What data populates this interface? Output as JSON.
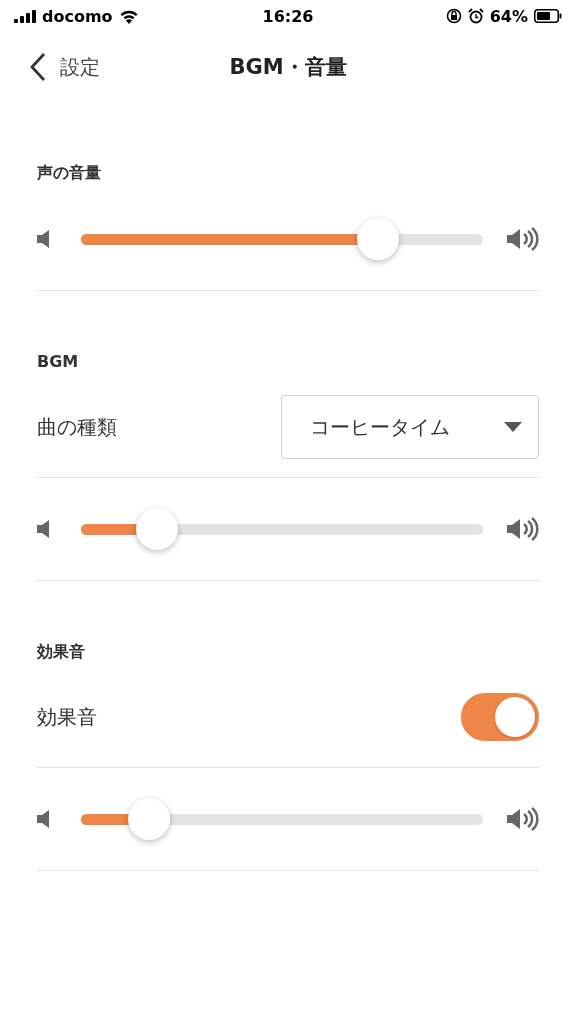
{
  "status_bar": {
    "carrier": "docomo",
    "time": "16:26",
    "battery": "64%"
  },
  "nav": {
    "back": "設定",
    "title": "BGM・音量"
  },
  "sections": [
    {
      "title": "声の音量",
      "rows": [
        {
          "kind": "slider",
          "level": 0.74
        }
      ]
    },
    {
      "title": "BGM",
      "rows": [
        {
          "kind": "select",
          "label": "曲の種類",
          "value": "コーヒータイム"
        },
        {
          "kind": "slider",
          "level": 0.19
        }
      ]
    },
    {
      "title": "効果音",
      "rows": [
        {
          "kind": "toggle",
          "label": "効果音",
          "on": true
        },
        {
          "kind": "slider",
          "level": 0.17
        }
      ]
    }
  ]
}
